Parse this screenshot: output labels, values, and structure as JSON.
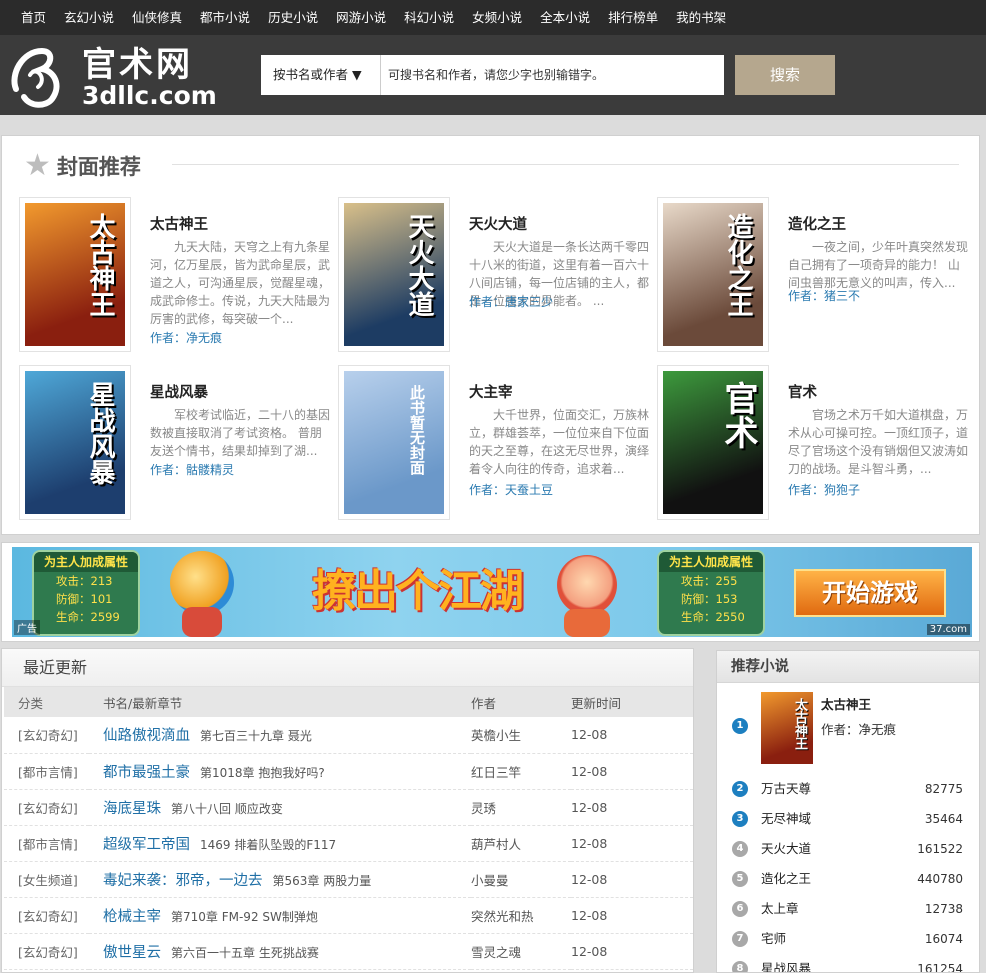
{
  "nav": {
    "items": [
      "首页",
      "玄幻小说",
      "仙侠修真",
      "都市小说",
      "历史小说",
      "网游小说",
      "科幻小说",
      "女频小说",
      "全本小说",
      "排行榜单",
      "我的书架"
    ]
  },
  "header": {
    "logo_cn": "官术网",
    "logo_en": "3dllc.com",
    "search_scope": "按书名或作者 ▼",
    "search_placeholder": "可搜书名和作者，请您少字也别输错字。",
    "search_button": "搜索"
  },
  "covers": {
    "title": "封面推荐",
    "author_prefix": "作者：",
    "books": [
      {
        "title": "太古神王",
        "desc": "九天大陆，天穹之上有九条星河，亿万星辰，皆为武命星辰，武道之人，可沟通星辰，觉醒星魂，成武命修士。传说，九天大陆最为厉害的武修，每突破一个...",
        "author": "净无痕",
        "cover_text": "太古神王",
        "cover_colors": [
          "#8a1f0f",
          "#f29a2e"
        ]
      },
      {
        "title": "天火大道",
        "desc": "天火大道是一条长达两千零四十八米的街道，这里有着一百六十八间店铺，每一位店铺的主人，都是一位强大的异能者。 ...",
        "author": "唐家三少",
        "cover_text": "天火大道",
        "cover_colors": [
          "#1d3c63",
          "#d9c08a"
        ]
      },
      {
        "title": "造化之王",
        "desc": "一夜之间，少年叶真突然发现自己拥有了一项奇异的能力！ 山间虫兽那无意义的叫声，传入...",
        "author": "猪三不",
        "cover_text": "造化之王",
        "cover_colors": [
          "#6b4a3a",
          "#e8d9c9"
        ]
      },
      {
        "title": "星战风暴",
        "desc": "军校考试临近，二十八的基因数被直接取消了考试资格。 普朋友送个情书，结果却掉到了湖...",
        "author": "骷髅精灵",
        "cover_text": "星战风暴",
        "cover_colors": [
          "#1d3e6e",
          "#4fa8d8"
        ]
      },
      {
        "title": "大主宰",
        "desc": "大千世界，位面交汇，万族林立，群雄荟萃，一位位来自下位面的天之至尊，在这无尽世界，演绎着令人向往的传奇，追求着...",
        "author": "天蚕土豆",
        "cover_text": "此书暂无封面",
        "cover_colors": [
          "#6b98c9",
          "#b8d0ec"
        ]
      },
      {
        "title": "官术",
        "desc": "官场之术万千如大道棋盘，万术从心可操可控。一顶红顶子，道尽了官场这个没有销烟但又波涛如刀的战场。是斗智斗勇，...",
        "author": "狗狍子",
        "cover_text": "官术",
        "cover_colors": [
          "#111111",
          "#3d9a3d"
        ]
      }
    ]
  },
  "ad": {
    "left_box": {
      "title": "为主人加成属性",
      "attack": "攻击：213",
      "defense": "防御：101",
      "life": "生命：2599"
    },
    "right_box": {
      "title": "为主人加成属性",
      "attack": "攻击：255",
      "defense": "防御：153",
      "life": "生命：2550"
    },
    "slogan": "撩出个江湖",
    "play": "开始游戏",
    "tag": "广告",
    "source": "37.com"
  },
  "latest": {
    "title": "最近更新",
    "headers": [
      "分类",
      "书名/最新章节",
      "作者",
      "更新时间"
    ],
    "rows": [
      {
        "cat": "[玄幻奇幻]",
        "book": "仙路傲视滴血",
        "chapter": "第七百三十九章 聂光",
        "author": "英檐小生",
        "time": "12-08"
      },
      {
        "cat": "[都市言情]",
        "book": "都市最强土豪",
        "chapter": "第1018章 抱抱我好吗?",
        "author": "红日三竿",
        "time": "12-08"
      },
      {
        "cat": "[玄幻奇幻]",
        "book": "海底星珠",
        "chapter": "第八十八回 顺应改变",
        "author": "灵琇",
        "time": "12-08"
      },
      {
        "cat": "[都市言情]",
        "book": "超级军工帝国",
        "chapter": "1469 排着队坠毁的F117",
        "author": "葫芦村人",
        "time": "12-08"
      },
      {
        "cat": "[女生频道]",
        "book": "毒妃来袭：邪帝，一边去",
        "chapter": "第563章 两股力量",
        "author": "小曼曼",
        "time": "12-08"
      },
      {
        "cat": "[玄幻奇幻]",
        "book": "枪械主宰",
        "chapter": "第710章 FM-92 SW制弹炮",
        "author": "突然光和热",
        "time": "12-08"
      },
      {
        "cat": "[玄幻奇幻]",
        "book": "傲世星云",
        "chapter": "第六百一十五章 生死挑战赛",
        "author": "雪灵之魂",
        "time": "12-08"
      }
    ]
  },
  "recommend": {
    "title": "推荐小说",
    "first": {
      "rank": "1",
      "title": "太古神王",
      "author": "作者：净无痕",
      "cover_text": "太古神王"
    },
    "items": [
      {
        "rank": "2",
        "name": "万古天尊",
        "count": "82775"
      },
      {
        "rank": "3",
        "name": "无尽神域",
        "count": "35464"
      },
      {
        "rank": "4",
        "name": "天火大道",
        "count": "161522"
      },
      {
        "rank": "5",
        "name": "造化之王",
        "count": "440780"
      },
      {
        "rank": "6",
        "name": "太上章",
        "count": "12738"
      },
      {
        "rank": "7",
        "name": "宅师",
        "count": "16074"
      },
      {
        "rank": "8",
        "name": "星战风暴",
        "count": "161254"
      }
    ]
  },
  "colors": {
    "link": "#1f6fa6",
    "nav_bg": "#2b2b2b",
    "header_bg": "#3b3b3b",
    "search_btn": "#b5a78e",
    "rank_blue": "#1d7fc0",
    "rank_gray": "#a8a8a8"
  }
}
